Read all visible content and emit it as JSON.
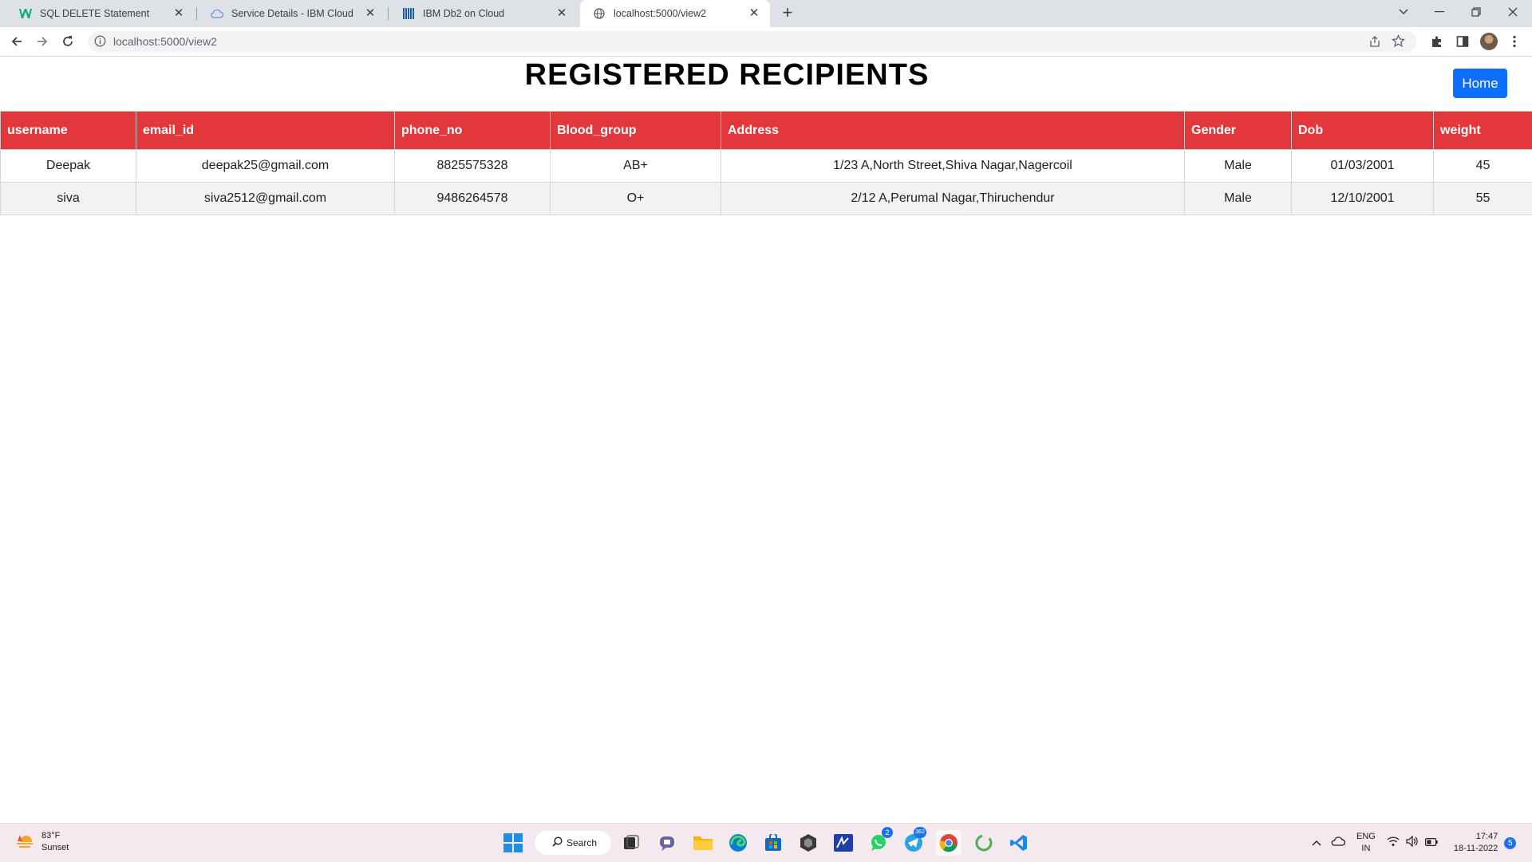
{
  "browser": {
    "tabs": [
      {
        "title": "SQL DELETE Statement",
        "icon": "w3schools-icon",
        "active": false
      },
      {
        "title": "Service Details - IBM Cloud",
        "icon": "cloud-icon",
        "active": false
      },
      {
        "title": "IBM Db2 on Cloud",
        "icon": "db2-icon",
        "active": false
      },
      {
        "title": "localhost:5000/view2",
        "icon": "globe-icon",
        "active": true
      }
    ],
    "url": "localhost:5000/view2"
  },
  "page": {
    "title": "REGISTERED RECIPIENTS",
    "home_label": "Home"
  },
  "table": {
    "headers": [
      "username",
      "email_id",
      "phone_no",
      "Blood_group",
      "Address",
      "Gender",
      "Dob",
      "weight"
    ],
    "rows": [
      [
        "Deepak",
        "deepak25@gmail.com",
        "8825575328",
        "AB+",
        "1/23 A,North Street,Shiva Nagar,Nagercoil",
        "Male",
        "01/03/2001",
        "45"
      ],
      [
        "siva",
        "siva2512@gmail.com",
        "9486264578",
        "O+",
        "2/12 A,Perumal Nagar,Thiruchendur",
        "Male",
        "12/10/2001",
        "55"
      ]
    ]
  },
  "taskbar": {
    "weather": {
      "temp": "83°F",
      "condition": "Sunset"
    },
    "search_label": "Search",
    "whatsapp_badge": "2",
    "telegram_badge": "362",
    "language": {
      "lang": "ENG",
      "region": "IN"
    },
    "clock": {
      "time": "17:47",
      "date": "18-11-2022"
    },
    "notification_count": "5"
  },
  "colors": {
    "header_bg": "#e2383c",
    "home_button": "#0d6efd",
    "alt_row": "#f2f2f2"
  }
}
